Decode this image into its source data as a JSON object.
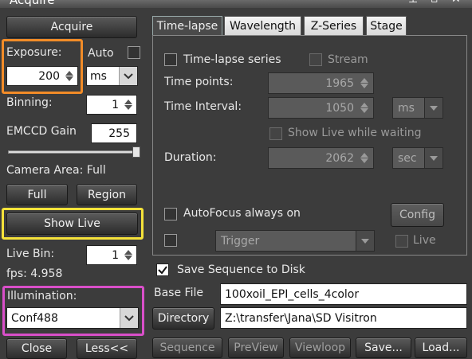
{
  "window": {
    "title": "Acquire"
  },
  "left": {
    "acquire_label": "Acquire",
    "exposure": {
      "label": "Exposure:",
      "value": "200",
      "unit": "ms"
    },
    "auto_label": "Auto",
    "binning": {
      "label": "Binning:",
      "value": "1"
    },
    "emccd_gain": {
      "label": "EMCCD Gain",
      "value": "255",
      "slider_fraction": 1.0
    },
    "camera_area_label": "Camera Area: Full",
    "full_label": "Full",
    "region_label": "Region",
    "show_live_label": "Show Live",
    "live_bin": {
      "label": "Live Bin:",
      "value": "1"
    },
    "fps_label": "fps: 4.958",
    "illumination": {
      "label": "Illumination:",
      "value": "Conf488"
    },
    "close_label": "Close",
    "less_label": "Less<<"
  },
  "tabs": [
    {
      "label": "Time-lapse"
    },
    {
      "label": "Wavelength"
    },
    {
      "label": "Z-Series"
    },
    {
      "label": "Stage"
    }
  ],
  "timelapse": {
    "series_label": "Time-lapse series",
    "stream_label": "Stream",
    "time_points_label": "Time points:",
    "time_points_value": "1965",
    "interval_label": "Time Interval:",
    "interval_value": "1050",
    "interval_unit": "ms",
    "show_live_waiting_label": "Show Live while waiting",
    "duration_label": "Duration:",
    "duration_value": "2062",
    "duration_unit": "sec",
    "autofocus_label": "AutoFocus always on",
    "config_label": "Config",
    "trigger_label": "Trigger",
    "live_label": "Live"
  },
  "save": {
    "save_sequence_label": "Save Sequence to Disk",
    "base_file_label": "Base File",
    "base_file_value": "100xoil_EPI_cells_4color",
    "directory_label": "Directory",
    "directory_value": "Z:\\transfer\\Jana\\SD Visitron",
    "sequence_label": "Sequence",
    "preview_label": "PreView",
    "viewloop_label": "Viewloop",
    "saveas_label": "Save...",
    "load_label": "Load..."
  },
  "highlight_colors": {
    "orange": "#f28c28",
    "yellow": "#f5e23a",
    "magenta": "#d94fc9"
  }
}
